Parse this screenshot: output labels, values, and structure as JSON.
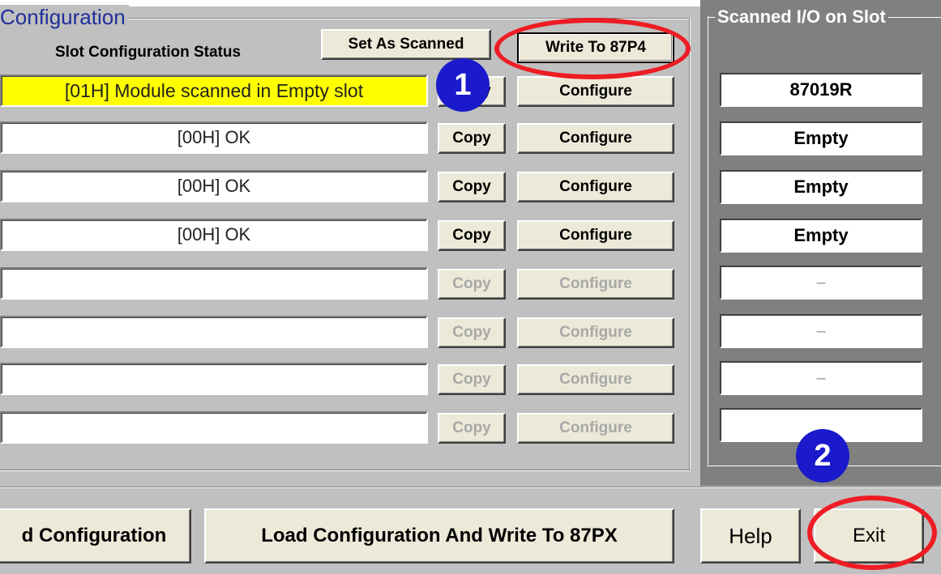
{
  "window": {
    "group_title": "Configuration",
    "status_header": "Slot Configuration Status"
  },
  "toolbar": {
    "set_as_scanned": "Set As Scanned",
    "write_to": "Write To 87P4"
  },
  "slots": [
    {
      "status": "[01H] Module scanned in Empty slot",
      "copy": "Copy",
      "configure": "Configure"
    },
    {
      "status": "[00H] OK",
      "copy": "Copy",
      "configure": "Configure"
    },
    {
      "status": "[00H] OK",
      "copy": "Copy",
      "configure": "Configure"
    },
    {
      "status": "[00H] OK",
      "copy": "Copy",
      "configure": "Configure"
    },
    {
      "status": "",
      "copy": "Copy",
      "configure": "Configure"
    },
    {
      "status": "",
      "copy": "Copy",
      "configure": "Configure"
    },
    {
      "status": "",
      "copy": "Copy",
      "configure": "Configure"
    },
    {
      "status": "",
      "copy": "Copy",
      "configure": "Configure"
    }
  ],
  "scanned_io": {
    "title": "Scanned I/O on Slot",
    "items": [
      "87019R",
      "Empty",
      "Empty",
      "Empty",
      "–",
      "–",
      "–",
      ""
    ]
  },
  "bottom_buttons": {
    "save_config": "d Configuration",
    "load_write": "Load  Configuration And Write To 87PX",
    "help": "Help",
    "exit": "Exit"
  },
  "annotations": {
    "step1": "1",
    "step2": "2"
  },
  "colors": {
    "warning_field": "#ffff00",
    "annotation_ring": "#ee1c24",
    "annotation_badge": "#1a1acc",
    "title_text": "#1f2f9a"
  }
}
